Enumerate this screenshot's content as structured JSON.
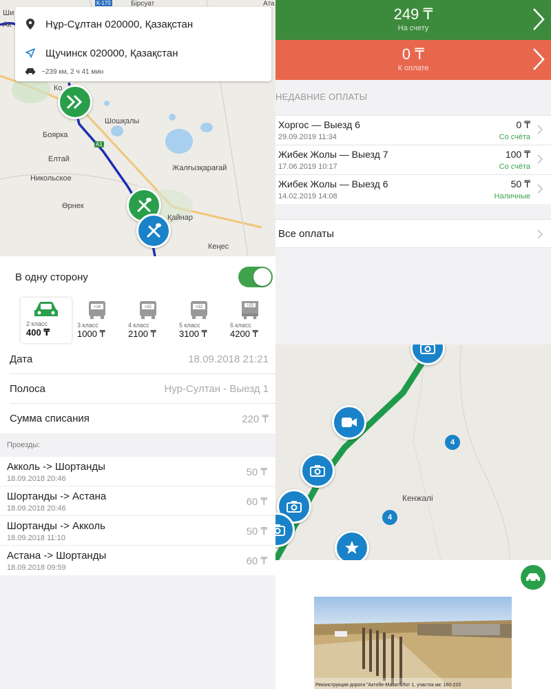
{
  "route": {
    "from": "Нұр-Сұлтан 020000, Қазақстан",
    "to": "Щучинск 020000, Қазақстан",
    "meta": "~239 км, 2 ч 41 мин",
    "map_labels": [
      "Ши",
      "Ак",
      "Ко",
      "Шошқалы",
      "Бояркa",
      "A1",
      "Елтай",
      "Жалғызқарағай",
      "Никольское",
      "Өрнек",
      "Қайнар",
      "Кеңес",
      "Бірсуат",
      "Ата",
      "К-170"
    ],
    "one_way_label": "В одну сторону",
    "one_way_on": true,
    "classes": [
      {
        "badge": "",
        "name": "2 класс",
        "price": "400 ₸",
        "selected": true
      },
      {
        "badge": "<16",
        "name": "3 класс",
        "price": "1000 ₸",
        "selected": false
      },
      {
        "badge": "<32",
        "name": "4 класс",
        "price": "2100 ₸",
        "selected": false
      },
      {
        "badge": ">32",
        "name": "5 класс",
        "price": "3100 ₸",
        "selected": false
      },
      {
        "badge": ">15",
        "name": "6 класс",
        "price": "4200 ₸",
        "selected": false
      }
    ]
  },
  "payments": {
    "balance": {
      "amount": "249 ₸",
      "label": "На счету",
      "color": "#3c8b3c"
    },
    "due": {
      "amount": "0 ₸",
      "label": "К оплате",
      "color": "#e8674c"
    },
    "recent_header": "Недавние оплаты",
    "items": [
      {
        "name": "Хоргос — Выезд 6",
        "date": "29.09.2019 11:34",
        "amount": "0 ₸",
        "method": "Со счёта"
      },
      {
        "name": "Жибек Жолы — Выезд 7",
        "date": "17.06.2019 10:17",
        "amount": "100 ₸",
        "method": "Со счёта"
      },
      {
        "name": "Жибек Жолы — Выезд 6",
        "date": "14.02.2019 14:08",
        "amount": "50 ₸",
        "method": "Наличные"
      }
    ],
    "all_label": "Все оплаты"
  },
  "details": {
    "rows": [
      {
        "key": "Дата",
        "value": "18.09.2018 21:21"
      },
      {
        "key": "Полоса",
        "value": "Нур-Султан - Выезд 1"
      },
      {
        "key": "Сумма списания",
        "value": "220 ₸"
      }
    ],
    "trips_header": "Проезды:",
    "trips": [
      {
        "route": "Акколь -> Шортанды",
        "date": "18.09.2018 20:46",
        "price": "50 ₸"
      },
      {
        "route": "Шортанды -> Астана",
        "date": "18.09.2018 20:46",
        "price": "60 ₸"
      },
      {
        "route": "Шортанды -> Акколь",
        "date": "18.09.2018 11:10",
        "price": "50 ₸"
      },
      {
        "route": "Астана -> Шортанды",
        "date": "18.09.2018 09:59",
        "price": "60 ₸"
      }
    ]
  },
  "map2": {
    "place_label": "Кенжалі",
    "cluster_count_1": "4",
    "cluster_count_2": "4",
    "photo_caption": "Реконструкция дороги \"Актобе-Макат\" Лот 1, участок км: 160-220"
  },
  "colors": {
    "green": "#3c8b3c",
    "orange": "#e8674c",
    "blue": "#1a82c8",
    "road_green": "#1f9a4c",
    "route_blue": "#1f2fb4"
  }
}
